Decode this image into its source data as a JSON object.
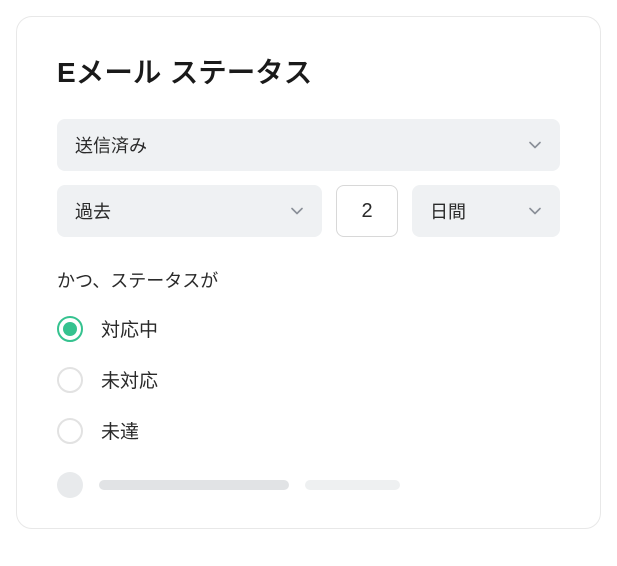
{
  "title": "Eメール ステータス",
  "statusSelect": {
    "value": "送信済み"
  },
  "timingSelect": {
    "value": "過去"
  },
  "numberInput": {
    "value": "2"
  },
  "unitSelect": {
    "value": "日間"
  },
  "sublabel": "かつ、ステータスが",
  "radioOptions": [
    {
      "label": "対応中",
      "selected": true
    },
    {
      "label": "未対応",
      "selected": false
    },
    {
      "label": "未達",
      "selected": false
    }
  ]
}
